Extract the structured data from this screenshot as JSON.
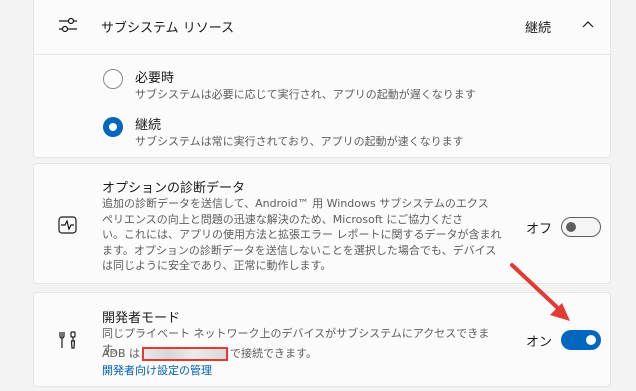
{
  "subsystem": {
    "title": "サブシステム リソース",
    "value": "継続",
    "options": [
      {
        "title": "必要時",
        "desc": "サブシステムは必要に応じて実行され、アプリの起動が遅くなります",
        "selected": false
      },
      {
        "title": "継続",
        "desc": "サブシステムは常に実行されており、アプリの起動が速くなります",
        "selected": true
      }
    ]
  },
  "diagnostics": {
    "title": "オプションの診断データ",
    "desc_lines": [
      "追加の診断データを送信して、Android™ 用 Windows サブシステムのエクス",
      "ペリエンスの向上と問題の迅速な解決のため、Microsoft にご協力くださ",
      "い。これには、アプリの使用方法と拡張エラー レポートに関するデータが含まれ",
      "ます。オプションの診断データを送信しないことを選択した場合でも、デバイス",
      "は同じように安全であり、正常に動作します。"
    ],
    "toggle_label": "オフ",
    "toggle_on": false
  },
  "developer": {
    "title": "開発者モード",
    "desc": "同じプライベート ネットワーク上のデバイスがサブシステムにアクセスできます。",
    "adb_prefix": "ADB は",
    "adb_suffix": "で接続できます。",
    "link": "開発者向け設定の管理",
    "toggle_label": "オン",
    "toggle_on": true
  },
  "colors": {
    "accent": "#0067c0",
    "annotation": "#e53935"
  }
}
